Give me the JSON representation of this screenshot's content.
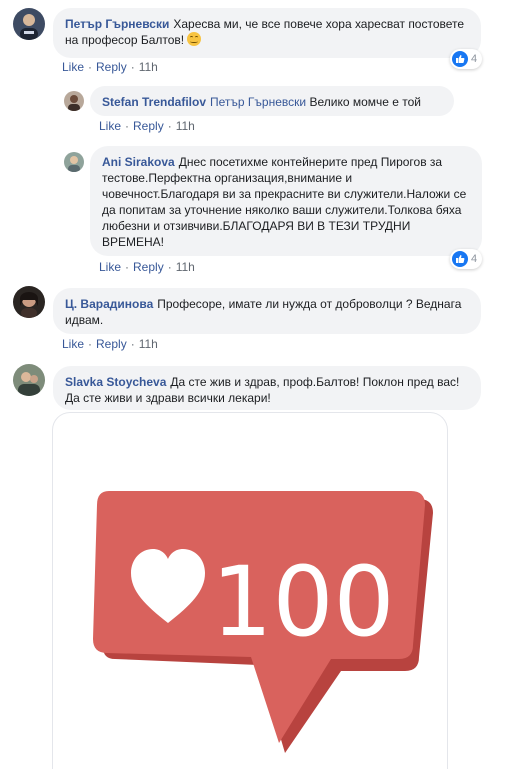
{
  "comments": [
    {
      "author": "Петър Гърневски",
      "text": "Харесва ми, че все повече хора харесват постовете на професор Балтов!",
      "emoji": "smiling-face",
      "like": "Like",
      "reply": "Reply",
      "time": "11h",
      "reactions": "4"
    },
    {
      "author": "Stefan Trendafilov",
      "mention": "Петър Гърневски",
      "text": "Велико момче е той",
      "like": "Like",
      "reply": "Reply",
      "time": "11h"
    },
    {
      "author": "Ani Sirakova",
      "text": "Днес посетихме контейнерите пред Пирогов за тестове.Перфектна организация,внимание и човечност.Благодаря ви за прекрасните ви служители.Наложи се да попитам за уточнение няколко ваши служители.Толкова бяха любезни и отзивчиви.БЛАГОДАРЯ ВИ В ТЕЗИ ТРУДНИ ВРЕМЕНА!",
      "like": "Like",
      "reply": "Reply",
      "time": "11h",
      "reactions": "4"
    },
    {
      "author": "Ц. Варадинова",
      "text": "Професоре, имате ли нужда от доброволци ? Веднага идвам.",
      "like": "Like",
      "reply": "Reply",
      "time": "11h"
    },
    {
      "author": "Slavka Stoycheva",
      "text": "Да сте жив и здрав, проф.Балтов! Поклон пред вас! Да сте живи и здрави всички лекари!"
    }
  ],
  "sticker": {
    "name": "heart-100-sticker",
    "label": "100",
    "color": "#d9625d",
    "shade": "#b8433f"
  },
  "colors": {
    "link": "#385898",
    "bubble": "#f2f3f5",
    "meta": "#606770",
    "like_blue": "#1877f2"
  }
}
